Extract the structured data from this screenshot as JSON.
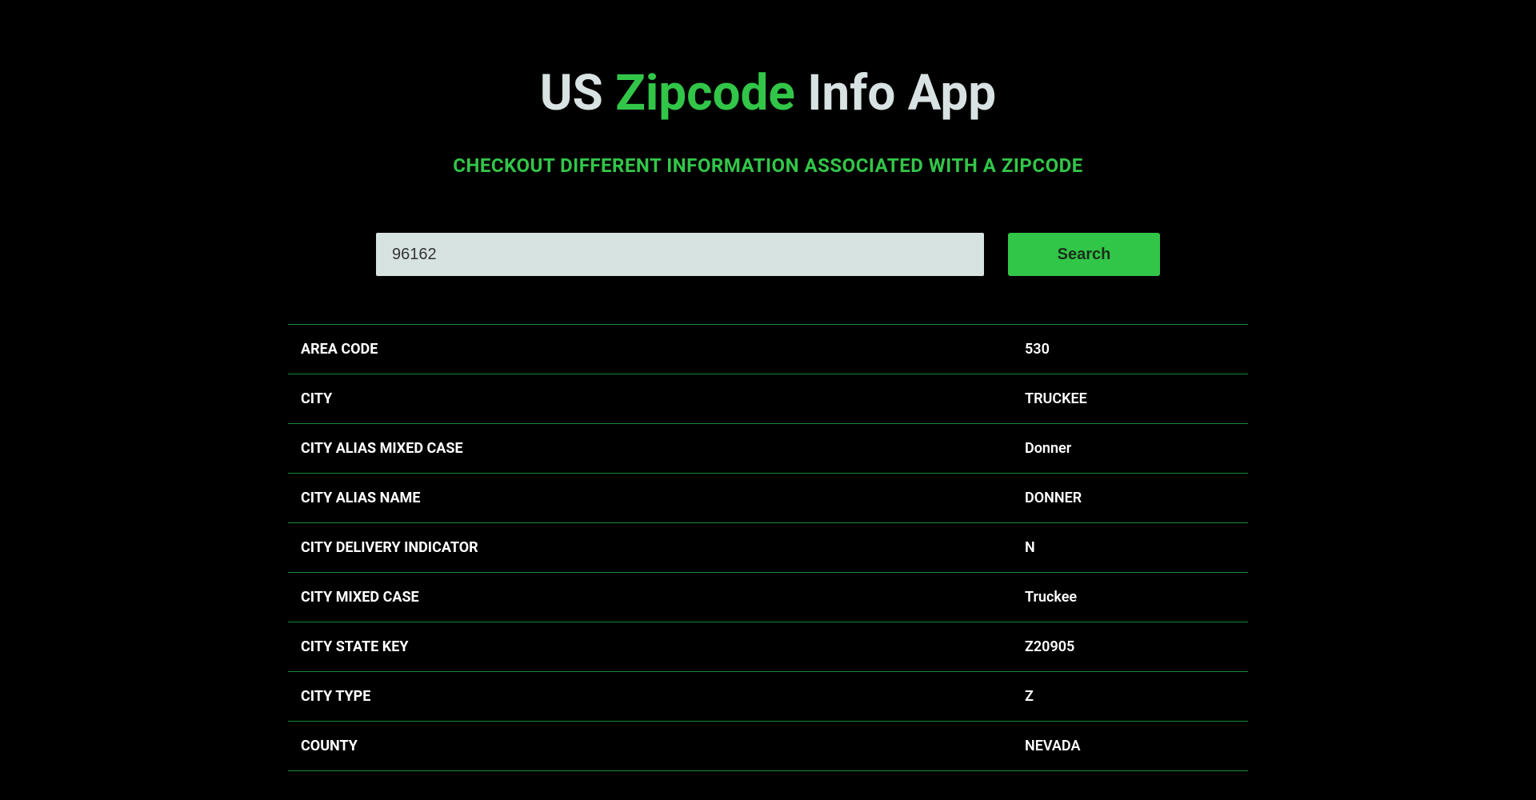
{
  "header": {
    "title_part1": "US ",
    "title_highlight": "Zipcode",
    "title_part2": " Info App",
    "subtitle": "CHECKOUT DIFFERENT INFORMATION ASSOCIATED WITH A ZIPCODE"
  },
  "search": {
    "input_value": "96162",
    "button_label": "Search"
  },
  "results": [
    {
      "label": "AREA CODE",
      "value": "530"
    },
    {
      "label": "CITY",
      "value": "TRUCKEE"
    },
    {
      "label": "CITY ALIAS MIXED CASE",
      "value": "Donner"
    },
    {
      "label": "CITY ALIAS NAME",
      "value": "DONNER"
    },
    {
      "label": "CITY DELIVERY INDICATOR",
      "value": "N"
    },
    {
      "label": "CITY MIXED CASE",
      "value": "Truckee"
    },
    {
      "label": "CITY STATE KEY",
      "value": "Z20905"
    },
    {
      "label": "CITY TYPE",
      "value": "Z"
    },
    {
      "label": "COUNTY",
      "value": "NEVADA"
    }
  ]
}
